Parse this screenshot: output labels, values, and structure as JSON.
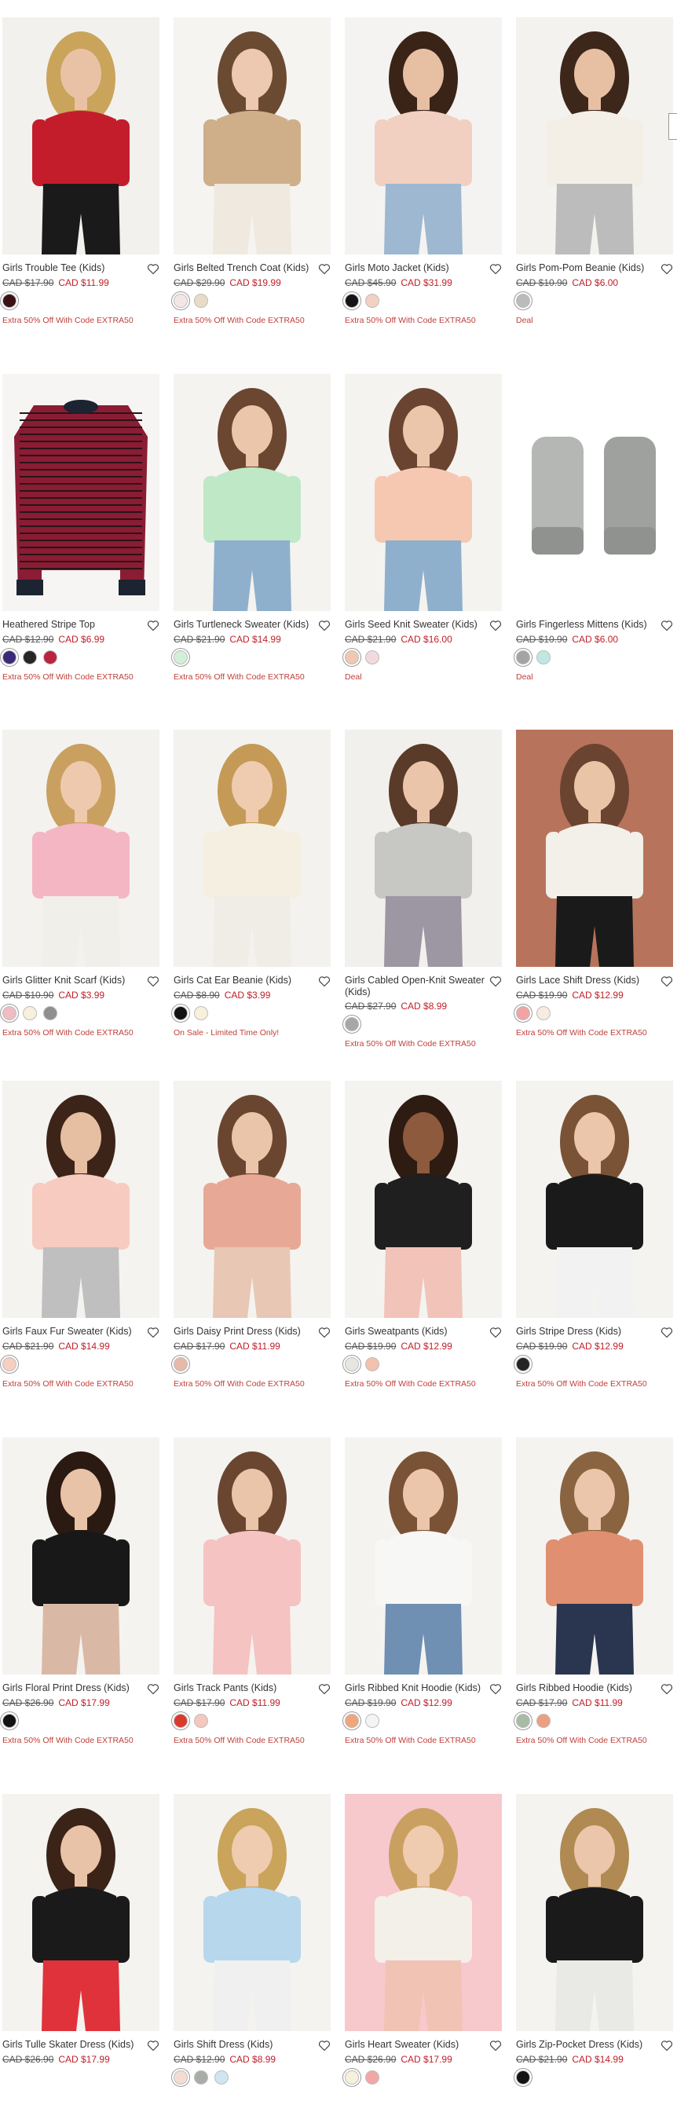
{
  "products": [
    {
      "name": "Girls Trouble Tee (Kids)",
      "old": "CAD $17.90",
      "price": "CAD $11.99",
      "swatches": [
        "#3a1216"
      ],
      "promo": "Extra 50% Off With Code EXTRA50",
      "img": {
        "bg": "#f2f1ee",
        "a": "#c31d2b",
        "b": "#1a1a1a",
        "hair": "#c9a45a",
        "skin": "#e9c2a6"
      }
    },
    {
      "name": "Girls Belted Trench Coat (Kids)",
      "old": "CAD $29.90",
      "price": "CAD $19.99",
      "swatches": [
        "#f5e6e6",
        "#e9dcc6"
      ],
      "promo": "Extra 50% Off With Code EXTRA50",
      "img": {
        "bg": "#f5f4f1",
        "a": "#cfae8a",
        "b": "#efe9df",
        "hair": "#6b4a32",
        "skin": "#ecc9b0"
      }
    },
    {
      "name": "Girls Moto Jacket (Kids)",
      "old": "CAD $45.90",
      "price": "CAD $31.99",
      "swatches": [
        "#141414",
        "#f1d1c4"
      ],
      "promo": "Extra 50% Off With Code EXTRA50",
      "img": {
        "bg": "#f4f3f1",
        "a": "#f1cfc1",
        "b": "#9db8d0",
        "hair": "#3a2418",
        "skin": "#e7bfa3"
      }
    },
    {
      "name": "Girls Pom-Pom Beanie (Kids)",
      "old": "CAD $10.90",
      "price": "CAD $6.00",
      "swatches": [
        "#b9bcb8"
      ],
      "promo": "Deal",
      "img": {
        "bg": "#f3f2ef",
        "a": "#f4efe6",
        "b": "#bcbcbc",
        "hair": "#3d261a",
        "skin": "#e7c0a4"
      }
    },
    {
      "name": "Heathered Stripe Top",
      "old": "CAD $12.90",
      "price": "CAD $6.99",
      "swatches": [
        "#3c2a78",
        "#262626",
        "#b8253c"
      ],
      "promo": "Extra 50% Off With Code EXTRA50",
      "img": {
        "bg": "#f6f5f3",
        "a": "#8a1c33",
        "b": "#1b2430",
        "hair": "",
        "skin": ""
      }
    },
    {
      "name": "Girls Turtleneck Sweater (Kids)",
      "old": "CAD $21.90",
      "price": "CAD $14.99",
      "swatches": [
        "#d2f0d8"
      ],
      "promo": "Extra 50% Off With Code EXTRA50",
      "img": {
        "bg": "#f4f3f0",
        "a": "#bfe8c7",
        "b": "#8fb0cc",
        "hair": "#6b4631",
        "skin": "#ebc6ab"
      }
    },
    {
      "name": "Girls Seed Knit Sweater (Kids)",
      "old": "CAD $21.90",
      "price": "CAD $16.00",
      "swatches": [
        "#f2c7b2",
        "#f3d9dd"
      ],
      "promo": "Deal",
      "img": {
        "bg": "#f4f3f0",
        "a": "#f6c8b2",
        "b": "#8fb0cc",
        "hair": "#6a4430",
        "skin": "#ecc6aa"
      }
    },
    {
      "name": "Girls Fingerless Mittens (Kids)",
      "old": "CAD $10.90",
      "price": "CAD $6.00",
      "swatches": [
        "#a3a5a3",
        "#bfe8e3"
      ],
      "promo": "Deal",
      "img": {
        "bg": "#ffffff",
        "a": "#b4b7b3",
        "b": "#9ea19d",
        "hair": "",
        "skin": ""
      }
    },
    {
      "name": "Girls Glitter Knit Scarf (Kids)",
      "old": "CAD $10.90",
      "price": "CAD $3.99",
      "swatches": [
        "#f2bcc4",
        "#f6f0dc",
        "#8f8f8f"
      ],
      "promo": "Extra 50% Off With Code EXTRA50",
      "img": {
        "bg": "#f3f2ef",
        "a": "#f4b6c2",
        "b": "#f1efea",
        "hair": "#c9a060",
        "skin": "#efc9ae"
      }
    },
    {
      "name": "Girls Cat Ear Beanie (Kids)",
      "old": "CAD $8.90",
      "price": "CAD $3.99",
      "swatches": [
        "#121212",
        "#f6f0dc"
      ],
      "promo": "On Sale - Limited Time Only!",
      "img": {
        "bg": "#f3f2ef",
        "a": "#f4efe0",
        "b": "#f0ede6",
        "hair": "#c59a57",
        "skin": "#efcbb0"
      }
    },
    {
      "name": "Girls Cabled Open-Knit Sweater (Kids)",
      "old": "CAD $27.90",
      "price": "CAD $8.99",
      "swatches": [
        "#a7a7a7"
      ],
      "promo": "Extra 50% Off With Code EXTRA50",
      "img": {
        "bg": "#f1f0ed",
        "a": "#c7c7c4",
        "b": "#9c97a3",
        "hair": "#5a3a28",
        "skin": "#ebc5a9"
      }
    },
    {
      "name": "Girls Lace Shift Dress (Kids)",
      "old": "CAD $19.90",
      "price": "CAD $12.99",
      "swatches": [
        "#f2a3a3",
        "#f6ece2"
      ],
      "promo": "Extra 50% Off With Code EXTRA50",
      "img": {
        "bg": "#b8735c",
        "a": "#f3efe9",
        "b": "#1a1a1a",
        "hair": "#6a4430",
        "skin": "#eac4a7"
      }
    },
    {
      "name": "Girls Faux Fur Sweater (Kids)",
      "old": "CAD $21.90",
      "price": "CAD $14.99",
      "swatches": [
        "#f6cfc0"
      ],
      "promo": "Extra 50% Off With Code EXTRA50",
      "img": {
        "bg": "#f4f3f0",
        "a": "#f8cbc0",
        "b": "#bfbfbf",
        "hair": "#3d2418",
        "skin": "#e6bea2"
      }
    },
    {
      "name": "Girls Daisy Print Dress (Kids)",
      "old": "CAD $17.90",
      "price": "CAD $11.99",
      "swatches": [
        "#e8b9a8"
      ],
      "promo": "Extra 50% Off With Code EXTRA50",
      "img": {
        "bg": "#f4f3f0",
        "a": "#e7a995",
        "b": "#e9c7b5",
        "hair": "#6a4631",
        "skin": "#ebc5a9"
      }
    },
    {
      "name": "Girls Sweatpants (Kids)",
      "old": "CAD $19.90",
      "price": "CAD $12.99",
      "swatches": [
        "#e6e6e2",
        "#f4c1ae"
      ],
      "promo": "Extra 50% Off With Code EXTRA50",
      "img": {
        "bg": "#f4f3f0",
        "a": "#1f1f1f",
        "b": "#f2c3b8",
        "hair": "#2e1b12",
        "skin": "#8d5a3d"
      }
    },
    {
      "name": "Girls Stripe Dress (Kids)",
      "old": "CAD $19.90",
      "price": "CAD $12.99",
      "swatches": [
        "#242424"
      ],
      "promo": "Extra 50% Off With Code EXTRA50",
      "img": {
        "bg": "#f4f3f0",
        "a": "#1a1a1a",
        "b": "#f2f2f2",
        "hair": "#7a5236",
        "skin": "#ecc6aa"
      }
    },
    {
      "name": "Girls Floral Print Dress (Kids)",
      "old": "CAD $26.90",
      "price": "CAD $17.99",
      "swatches": [
        "#121212"
      ],
      "promo": "Extra 50% Off With Code EXTRA50",
      "img": {
        "bg": "#f4f3f0",
        "a": "#181818",
        "b": "#d9b9a5",
        "hair": "#2b1a12",
        "skin": "#e9c3a7"
      }
    },
    {
      "name": "Girls Track Pants (Kids)",
      "old": "CAD $17.90",
      "price": "CAD $11.99",
      "swatches": [
        "#d93a2e",
        "#f4c7bf"
      ],
      "promo": "Extra 50% Off With Code EXTRA50",
      "img": {
        "bg": "#f4f3f0",
        "a": "#f5c3c1",
        "b": "#f5c3c1",
        "hair": "#6a4631",
        "skin": "#ebc5a9"
      }
    },
    {
      "name": "Girls Ribbed Knit Hoodie (Kids)",
      "old": "CAD $19.90",
      "price": "CAD $12.99",
      "swatches": [
        "#f0a57d",
        "#f4f4f4"
      ],
      "promo": "Extra 50% Off With Code EXTRA50",
      "img": {
        "bg": "#f4f3f0",
        "a": "#f7f7f5",
        "b": "#6f8fb3",
        "hair": "#7a5236",
        "skin": "#ecc6aa"
      }
    },
    {
      "name": "Girls Ribbed Hoodie (Kids)",
      "old": "CAD $17.90",
      "price": "CAD $11.99",
      "swatches": [
        "#a9bba5",
        "#ed9f80"
      ],
      "promo": "Extra 50% Off With Code EXTRA50",
      "img": {
        "bg": "#f4f3f0",
        "a": "#e08f71",
        "b": "#2a3550",
        "hair": "#8a6440",
        "skin": "#ecc6aa"
      }
    },
    {
      "name": "Girls Tulle Skater Dress (Kids)",
      "old": "CAD $26.90",
      "price": "CAD $17.99",
      "swatches": [],
      "promo": "",
      "img": {
        "bg": "#f4f3f0",
        "a": "#1a1a1a",
        "b": "#e0323a",
        "hair": "#3b2417",
        "skin": "#e9c3a7"
      }
    },
    {
      "name": "Girls Shift Dress (Kids)",
      "old": "CAD $12.90",
      "price": "CAD $8.99",
      "swatches": [
        "#f4dcd3",
        "#a9ada8",
        "#cfe6f2"
      ],
      "promo": "",
      "img": {
        "bg": "#f4f3f0",
        "a": "#b7d7ec",
        "b": "#f0f0f0",
        "hair": "#c9a45a",
        "skin": "#efcbb0"
      }
    },
    {
      "name": "Girls Heart Sweater (Kids)",
      "old": "CAD $26.90",
      "price": "CAD $17.99",
      "swatches": [
        "#f6f0dc",
        "#f3a7a5"
      ],
      "promo": "",
      "img": {
        "bg": "#f7c9cc",
        "a": "#f3efe9",
        "b": "#f0c3b5",
        "hair": "#c9a060",
        "skin": "#efcbb0"
      }
    },
    {
      "name": "Girls Zip-Pocket Dress (Kids)",
      "old": "CAD $21.90",
      "price": "CAD $14.99",
      "swatches": [
        "#141414"
      ],
      "promo": "",
      "img": {
        "bg": "#f4f3f0",
        "a": "#1a1a1a",
        "b": "#e9e9e6",
        "hair": "#b08a52",
        "skin": "#ecc6aa"
      }
    }
  ],
  "icons": {
    "favorite": "heart-outline-icon"
  }
}
